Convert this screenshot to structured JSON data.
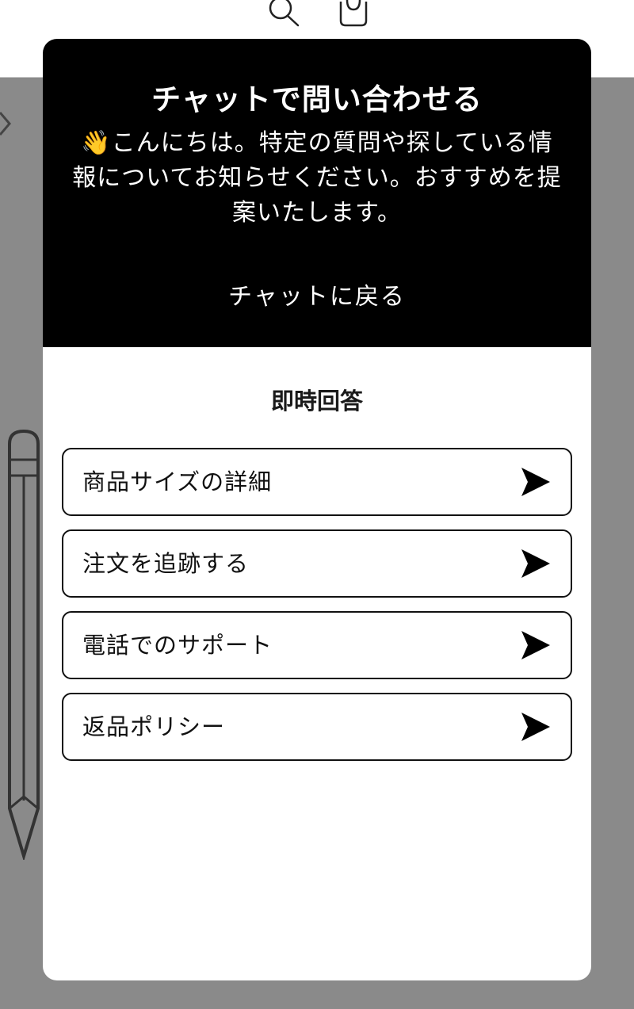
{
  "chat": {
    "title": "チャットで問い合わせる",
    "greeting": "👋こんにちは。特定の質問や探している情報についてお知らせください。おすすめを提案いたします。",
    "back_label": "チャットに戻る",
    "quick_answers_title": "即時回答",
    "quick_answers": [
      {
        "label": "商品サイズの詳細"
      },
      {
        "label": "注文を追跡する"
      },
      {
        "label": "電話でのサポート"
      },
      {
        "label": "返品ポリシー"
      }
    ]
  }
}
